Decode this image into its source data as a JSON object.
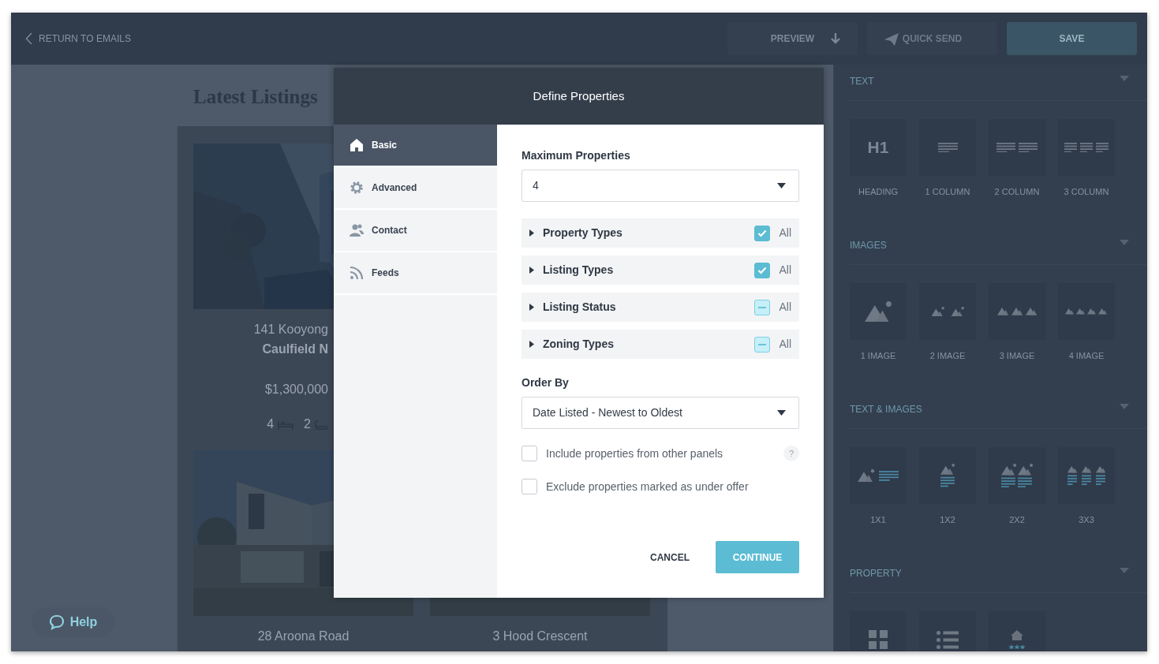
{
  "top_bar": {
    "back_link": "RETURN TO EMAILS",
    "buttons": [
      {
        "label": "PREVIEW",
        "kind": "preview",
        "disabled": false
      },
      {
        "label": "QUICK SEND",
        "kind": "send",
        "disabled": true
      },
      {
        "label": "SAVE",
        "kind": "save",
        "disabled": false
      }
    ]
  },
  "email_canvas": {
    "heading": "Latest Listings",
    "rows": [
      {
        "cards": [
          {
            "address": "141 Kooyong",
            "suburb": "Caulfield N",
            "price": "$1,300,000",
            "beds": "4",
            "baths": "2"
          }
        ]
      },
      {
        "cards": [
          {
            "address": "28 Aroona Road"
          },
          {
            "address": "3 Hood Crescent"
          }
        ]
      }
    ]
  },
  "help_button": {
    "label": "Help"
  },
  "sidebar": {
    "sections": [
      {
        "title": "TEXT",
        "expanded": true,
        "tiles": [
          {
            "kind": "heading",
            "glyph": "H1",
            "label": "HEADING"
          },
          {
            "kind": "onecol",
            "label": "1 COLUMN"
          },
          {
            "kind": "twocol",
            "label": "2 COLUMN"
          },
          {
            "kind": "threecol",
            "label": "3 COLUMN"
          }
        ]
      },
      {
        "title": "IMAGES",
        "expanded": true,
        "tiles": [
          {
            "kind": "oneimage",
            "label": "1 IMAGE"
          },
          {
            "kind": "twoimage",
            "label": "2 IMAGE"
          },
          {
            "kind": "threeimage",
            "label": "3 IMAGE"
          },
          {
            "kind": "fourimage",
            "label": "4 IMAGE"
          }
        ]
      },
      {
        "title": "TEXT & IMAGES",
        "expanded": true,
        "tiles": [
          {
            "kind": "mixone",
            "label": "1X1"
          },
          {
            "kind": "mixstack",
            "label": "1X2"
          },
          {
            "kind": "mixtwo",
            "label": "2X2"
          },
          {
            "kind": "mixthree",
            "label": "3X3"
          }
        ]
      },
      {
        "title": "PROPERTY",
        "expanded": true,
        "tiles": [
          {
            "kind": "grid"
          },
          {
            "kind": "list"
          },
          {
            "kind": "featured"
          }
        ]
      }
    ]
  },
  "modal": {
    "title": "Define Properties",
    "nav": [
      {
        "label": "Basic",
        "kind": "home",
        "selected": true
      },
      {
        "label": "Advanced",
        "kind": "gear",
        "selected": false
      },
      {
        "label": "Contact",
        "kind": "people",
        "selected": false
      },
      {
        "label": "Feeds",
        "kind": "feed",
        "selected": false
      }
    ],
    "max_label": "Maximum Properties",
    "max_value": "4",
    "filters": [
      {
        "label": "Property Types",
        "expanded": false,
        "checked": true,
        "indeterminate": false,
        "all_label": "All"
      },
      {
        "label": "Listing Types",
        "expanded": false,
        "checked": true,
        "indeterminate": false,
        "all_label": "All"
      },
      {
        "label": "Listing Status",
        "expanded": false,
        "checked": false,
        "indeterminate": true,
        "all_label": "All"
      },
      {
        "label": "Zoning Types",
        "expanded": false,
        "checked": false,
        "indeterminate": true,
        "all_label": "All"
      }
    ],
    "order_label": "Order By",
    "order_value": "Date Listed - Newest to Oldest",
    "options": [
      {
        "label": "Include properties from other panels",
        "checked": false,
        "help": "?"
      },
      {
        "label": "Exclude properties marked as under offer",
        "checked": false
      }
    ],
    "cancel": "CANCEL",
    "continue": "CONTINUE"
  }
}
